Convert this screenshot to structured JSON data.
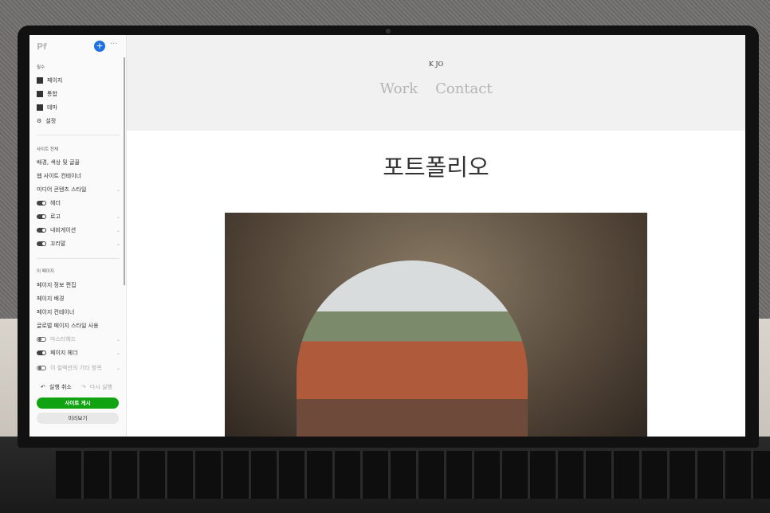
{
  "sidebar": {
    "logo": "Pf",
    "add": "+",
    "more": "···",
    "sections": {
      "essentials": "필수",
      "site": "사이트 전체",
      "page": "이 페이지"
    },
    "essentials": [
      {
        "label": "페이지",
        "icon": "page-icon"
      },
      {
        "label": "통합",
        "icon": "integration-icon"
      },
      {
        "label": "테마",
        "icon": "theme-icon"
      },
      {
        "label": "설정",
        "icon": "gear-icon"
      }
    ],
    "site": [
      {
        "label": "배경, 색상 및 글꼴"
      },
      {
        "label": "웹 사이트 컨테이너"
      },
      {
        "label": "미디어 콘텐츠 스타일"
      },
      {
        "label": "헤더",
        "toggle": true
      },
      {
        "label": "로고",
        "toggle": true
      },
      {
        "label": "내비게이션",
        "toggle": true
      },
      {
        "label": "꼬리말",
        "toggle": true
      }
    ],
    "page": [
      {
        "label": "페이지 정보 편집"
      },
      {
        "label": "페이지 배경"
      },
      {
        "label": "페이지 컨테이너"
      },
      {
        "label": "글로벌 페이지 스타일 사용"
      },
      {
        "label": "마스터헤드",
        "toggle": false
      },
      {
        "label": "페이지 헤더",
        "toggle": true
      },
      {
        "label": "이 컬렉션의 기타 항목",
        "toggle": false
      }
    ],
    "undo": "실행 취소",
    "redo": "다시 실행",
    "publish": "사이트 게시",
    "preview": "미리보기"
  },
  "site": {
    "brand": "K JO",
    "nav": [
      "Work",
      "Contact"
    ],
    "title": "포트폴리오"
  },
  "colors": {
    "publish": "#11a311",
    "add": "#1f6fde"
  }
}
